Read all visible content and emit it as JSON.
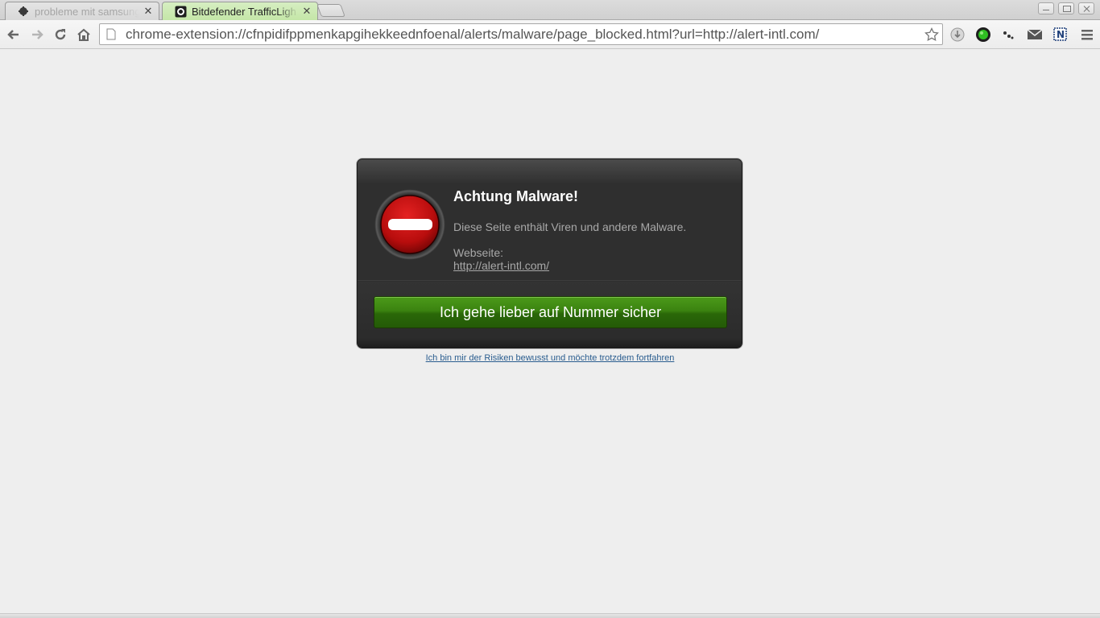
{
  "browser": {
    "tabs": [
      {
        "title": "probleme mit samsung",
        "active": false,
        "icon": "android-icon"
      },
      {
        "title": "Bitdefender TrafficLigh",
        "active": true,
        "icon": "bitdefender-icon"
      }
    ],
    "url": "chrome-extension://cfnpidifppmenkapgihekkeednfoenal/alerts/malware/page_blocked.html?url=http://alert-intl.com/",
    "toolbar_icons": [
      "back-icon",
      "forward-icon",
      "reload-icon",
      "home-icon",
      "page-icon",
      "star-icon"
    ],
    "extension_icons": [
      "download-icon",
      "trafficlight-green-icon",
      "dots-icon",
      "mail-icon",
      "n-extension-icon",
      "menu-icon"
    ]
  },
  "alert": {
    "title": "Achtung Malware!",
    "message": "Diese Seite enthält Viren und andere Malware.",
    "website_label": "Webseite:",
    "website_url": "http://alert-intl.com/",
    "safe_button_label": "Ich gehe lieber auf Nummer sicher",
    "proceed_link": "Ich bin mir der Risiken bewusst und möchte trotzdem fortfahren",
    "icon": "stop-icon"
  },
  "colors": {
    "page_background": "#eeeeee",
    "dialog_background": "#2f2f2f",
    "button_green": "#3b8310",
    "stop_red": "#cc1111",
    "active_tab": "#c4e6a7"
  }
}
